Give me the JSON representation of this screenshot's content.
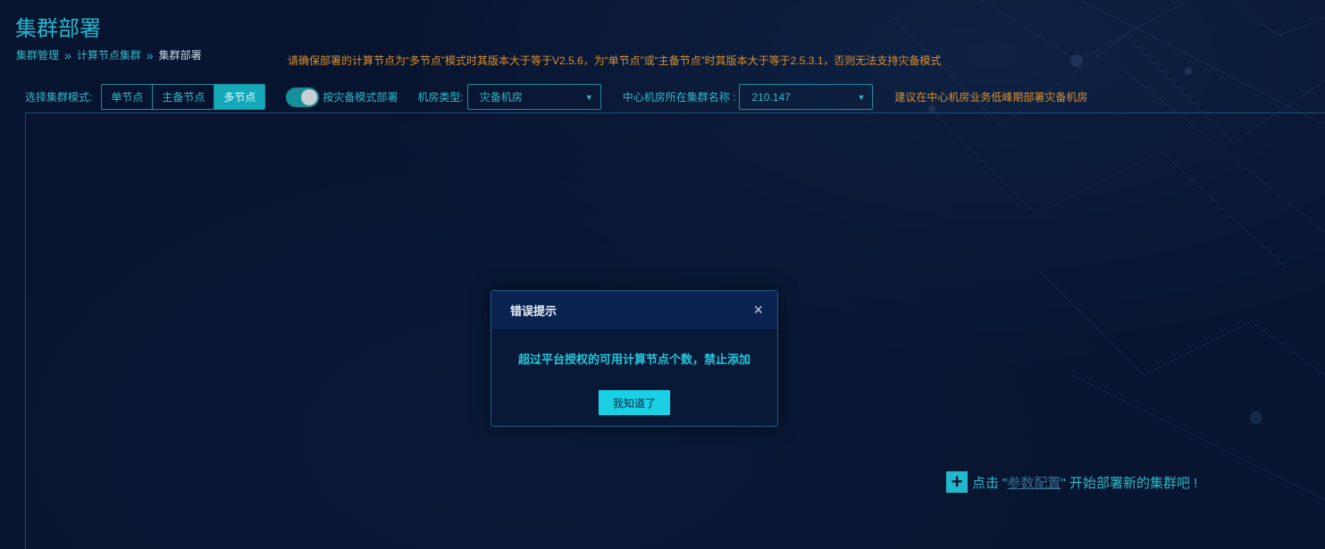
{
  "page": {
    "title": "集群部署",
    "warning": "请确保部署的计算节点为“多节点”模式时其版本大于等于V2.5.6，为“单节点”或“主备节点”时其版本大于等于2.5.3.1，否则无法支持灾备模式"
  },
  "breadcrumb": {
    "items": [
      "集群管理",
      "计算节点集群",
      "集群部署"
    ],
    "separator": "»"
  },
  "toolbar": {
    "mode_label": "选择集群模式:",
    "modes": [
      "单节点",
      "主备节点",
      "多节点"
    ],
    "active_mode": "多节点",
    "dr_toggle_label": "按灾备模式部署",
    "room_type_label": "机房类型:",
    "room_type_value": "灾备机房",
    "center_cluster_label": "中心机房所在集群名称 :",
    "center_cluster_value": "210.147",
    "hint": "建议在中心机房业务低峰期部署灾备机房",
    "dropdown_icon": "▼"
  },
  "cta": {
    "prefix": "点击 \"",
    "link": "参数配置",
    "suffix": "\" 开始部署新的集群吧 !",
    "plus_icon": "+"
  },
  "modal": {
    "title": "错误提示",
    "close_icon": "×",
    "message": "超过平台授权的可用计算节点个数，禁止添加",
    "button_label": "我知道了"
  },
  "colors": {
    "background": "#07142f",
    "accent": "#22b8cc",
    "warning": "#d9902e",
    "modal_button": "#19d0e4"
  }
}
